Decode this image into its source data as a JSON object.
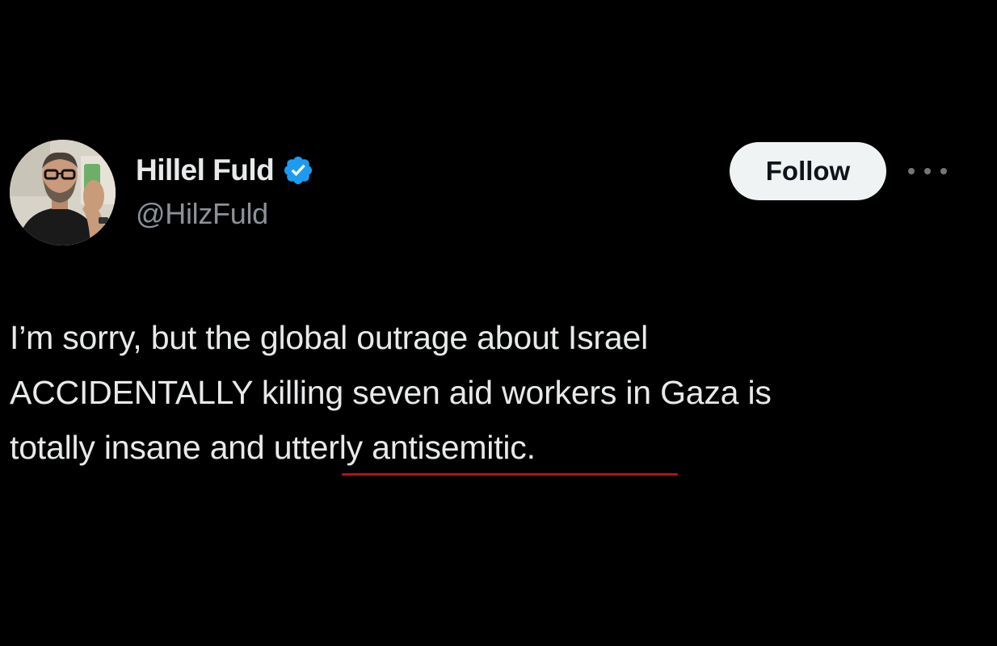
{
  "author": {
    "display_name": "Hillel Fuld",
    "handle": "@HilzFuld",
    "verified": true,
    "verified_badge_color": "#1d9bf0",
    "avatar_icon": "profile-photo"
  },
  "actions": {
    "follow_label": "Follow",
    "more_icon": "more-horizontal-icon"
  },
  "tweet": {
    "lines": [
      "I’m sorry, but the global outrage about Israel",
      "ACCIDENTALLY killing seven aid workers in Gaza is",
      "totally insane and utterly antisemitic."
    ],
    "underline_color": "#b3141c"
  },
  "colors": {
    "background": "#000000",
    "primary_text": "#e7e9ea",
    "secondary_text": "#8b9299",
    "follow_bg": "#eff3f4",
    "follow_text": "#0f1419"
  }
}
